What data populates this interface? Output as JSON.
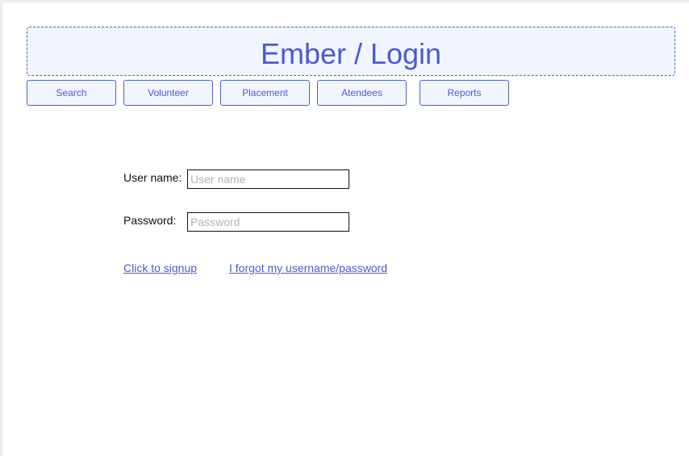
{
  "header": {
    "title": "Ember / Login"
  },
  "nav": {
    "items": [
      {
        "label": "Search"
      },
      {
        "label": "Volunteer"
      },
      {
        "label": "Placement"
      },
      {
        "label": "Atendees"
      },
      {
        "label": "Reports"
      }
    ]
  },
  "login_form": {
    "username_label": "User name:",
    "username_value": "",
    "username_placeholder": "User name",
    "password_label": "Password:",
    "password_value": "",
    "password_placeholder": "Password"
  },
  "links": {
    "signup": "Click to signup",
    "forgot": "I forgot my username/password"
  },
  "colors": {
    "accent": "#4a5ad4",
    "header_background": "#f1f5fd",
    "border": "#5060c8"
  }
}
